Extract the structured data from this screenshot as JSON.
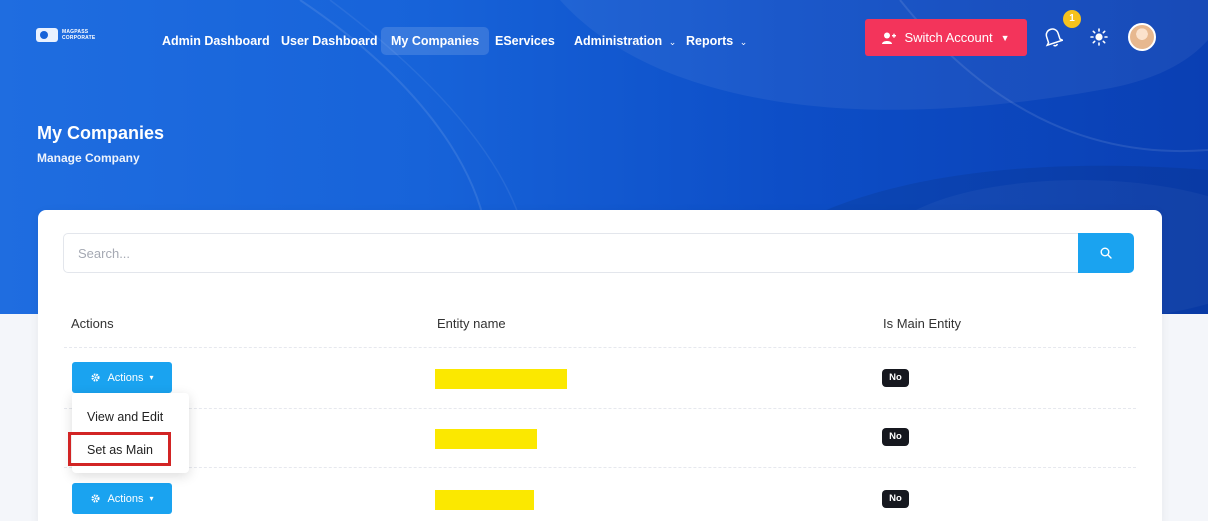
{
  "app": {
    "logo_line1": "MAGPASS",
    "logo_line2": "CORPORATE"
  },
  "nav": {
    "items": [
      {
        "label": "Admin Dashboard"
      },
      {
        "label": "User Dashboard"
      },
      {
        "label": "My Companies",
        "active": true
      },
      {
        "label": "EServices"
      },
      {
        "label": "Administration",
        "caret": "⌄"
      },
      {
        "label": "Reports",
        "caret": "⌄"
      }
    ],
    "switch_account_label": "Switch Account",
    "notification_count": "1"
  },
  "header": {
    "title": "My Companies",
    "subtitle": "Manage Company"
  },
  "search": {
    "placeholder": "Search..."
  },
  "table": {
    "columns": [
      "Actions",
      "Entity name",
      "Is Main Entity"
    ],
    "rows": [
      {
        "actions_label": "Actions",
        "entity_name": "",
        "is_main": "No"
      },
      {
        "actions_label": "",
        "entity_name": "",
        "is_main": "No"
      },
      {
        "actions_label": "Actions",
        "entity_name": "",
        "is_main": "No"
      }
    ]
  },
  "actions_menu": {
    "items": [
      {
        "label": "View and Edit"
      },
      {
        "label": "Set as Main"
      }
    ]
  },
  "colors": {
    "hero_blue": "#1763d9",
    "switch_account_red": "#f3345b",
    "action_button_blue": "#1aa3f0",
    "redacted_yellow": "#fbe800",
    "highlight_red": "#d22424",
    "badge_yellow": "#f6c21d"
  }
}
